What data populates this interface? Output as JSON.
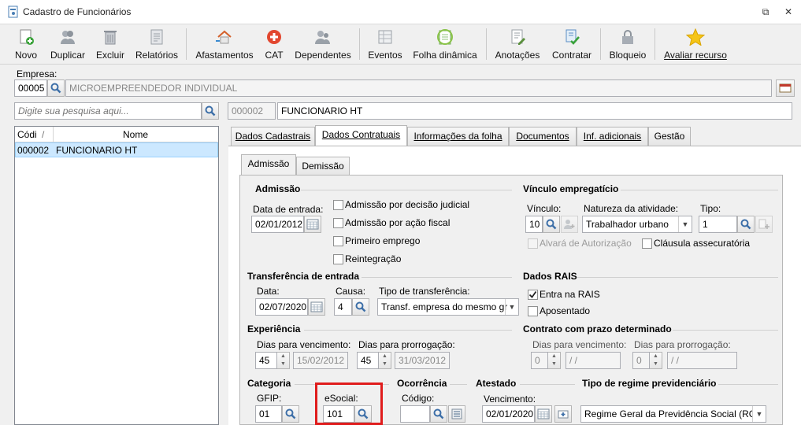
{
  "window": {
    "title": "Cadastro de Funcionários",
    "restore": "⧉",
    "close": "✕"
  },
  "toolbar": {
    "items": [
      {
        "label": "Novo",
        "icon": "new-icon"
      },
      {
        "label": "Duplicar",
        "icon": "duplicate-icon"
      },
      {
        "label": "Excluir",
        "icon": "trash-icon"
      },
      {
        "label": "Relatórios",
        "icon": "report-icon"
      },
      {
        "label": "Afastamentos",
        "icon": "house-icon"
      },
      {
        "label": "CAT",
        "icon": "medical-cross-icon"
      },
      {
        "label": "Dependentes",
        "icon": "people-icon"
      },
      {
        "label": "Eventos",
        "icon": "events-icon"
      },
      {
        "label": "Folha dinâmica",
        "icon": "calendar-sheet-icon"
      },
      {
        "label": "Anotações",
        "icon": "notes-icon"
      },
      {
        "label": "Contratar",
        "icon": "contract-icon"
      },
      {
        "label": "Bloqueio",
        "icon": "lock-icon"
      },
      {
        "label": "Avaliar recurso",
        "icon": "star-icon"
      }
    ]
  },
  "empresa": {
    "label": "Empresa:",
    "code": "00005",
    "name": "MICROEMPREENDEDOR INDIVIDUAL"
  },
  "search": {
    "placeholder": "Digite sua pesquisa aqui..."
  },
  "current": {
    "code": "000002",
    "name": "FUNCIONARIO HT"
  },
  "grid": {
    "columns": [
      "Códi",
      "Nome"
    ],
    "sort": "/",
    "rows": [
      {
        "code": "000002",
        "name": "FUNCIONARIO HT"
      }
    ]
  },
  "tabs": [
    "Dados Cadastrais",
    "Dados Contratuais",
    "Informações da folha",
    "Documentos",
    "Inf. adicionais",
    "Gestão"
  ],
  "subtabs": [
    "Admissão",
    "Demissão"
  ],
  "admissao": {
    "title": "Admissão",
    "data_label": "Data de entrada:",
    "data": "02/01/2012",
    "checks": [
      "Admissão por decisão judicial",
      "Admissão por ação fiscal",
      "Primeiro emprego",
      "Reintegração"
    ]
  },
  "vinculo": {
    "title": "Vínculo empregatício",
    "vinculo_label": "Vínculo:",
    "vinculo": "10",
    "natureza_label": "Natureza da atividade:",
    "natureza": "Trabalhador urbano",
    "tipo_label": "Tipo:",
    "tipo": "1",
    "alvara": "Alvará de Autorização",
    "clausula": "Cláusula assecuratória"
  },
  "transferencia": {
    "title": "Transferência de entrada",
    "data_label": "Data:",
    "data": "02/07/2020",
    "causa_label": "Causa:",
    "causa": "4",
    "tipo_label": "Tipo de transferência:",
    "tipo": "Transf. empresa do mesmo gr"
  },
  "rais": {
    "title": "Dados RAIS",
    "entra": "Entra na RAIS",
    "aposentado": "Aposentado"
  },
  "experiencia": {
    "title": "Experiência",
    "venc_label": "Dias para vencimento:",
    "venc_dias": "45",
    "venc_data": "15/02/2012",
    "prorr_label": "Dias para prorrogação:",
    "prorr_dias": "45",
    "prorr_data": "31/03/2012"
  },
  "contrato": {
    "title": "Contrato com prazo determinado",
    "venc_label": "Dias para vencimento:",
    "venc_dias": "0",
    "venc_data": "/ /",
    "prorr_label": "Dias para prorrogação:",
    "prorr_dias": "0",
    "prorr_data": "/ /"
  },
  "categoria": {
    "title": "Categoria",
    "gfip_label": "GFIP:",
    "gfip": "01",
    "esocial_label": "eSocial:",
    "esocial": "101"
  },
  "ocorrencia": {
    "title": "Ocorrência",
    "codigo_label": "Código:",
    "codigo": ""
  },
  "atestado": {
    "title": "Atestado",
    "venc_label": "Vencimento:",
    "venc": "02/01/2020"
  },
  "regime": {
    "title": "Tipo de regime previdenciário",
    "value": "Regime Geral da Previdência Social (RGP"
  },
  "colors": {
    "selection": "#cce8ff",
    "highlight": "#e01c1c"
  }
}
